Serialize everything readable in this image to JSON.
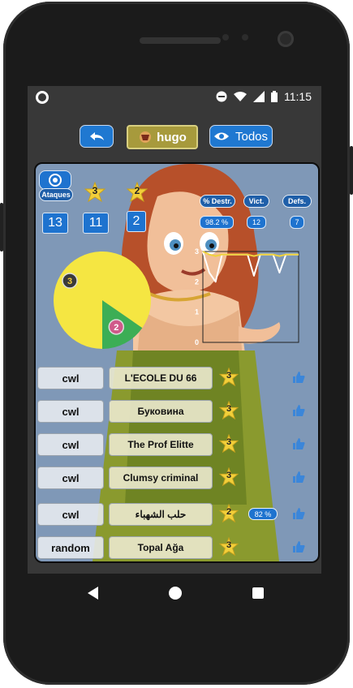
{
  "status": {
    "time": "11:15"
  },
  "toolbar": {
    "back_icon": "undo-icon",
    "player_name": "hugo",
    "filter_label": "Todos"
  },
  "stats": {
    "ataques_label": "Ataques",
    "ataques": "13",
    "three_star": "3",
    "three_star_count": "11",
    "two_star": "2",
    "two_star_count": "2",
    "destr_label": "% Destr.",
    "destr_value": "98.2 %",
    "vict_label": "Vict.",
    "vict_value": "12",
    "defs_label": "Defs.",
    "defs_value": "7"
  },
  "chart_data": [
    {
      "type": "pie",
      "slices": [
        {
          "label": "3",
          "value": 11,
          "color": "#f5e642"
        },
        {
          "label": "2",
          "value": 2,
          "color": "#3cae55"
        }
      ]
    },
    {
      "type": "line",
      "ylim": [
        0,
        3
      ],
      "yticks": [
        "0",
        "1",
        "2",
        "3"
      ],
      "series": [
        {
          "color": "#ffffff",
          "values": [
            3,
            2.3,
            2.0,
            2.9,
            2.9,
            2.9,
            2.9,
            2.9,
            2.2,
            2.9,
            2.9,
            2.9,
            2.3,
            2.9,
            2.9,
            2.9
          ]
        },
        {
          "color": "#f0d23c",
          "values": [
            3,
            2.9,
            2.85,
            2.9,
            2.9,
            2.9,
            2.9,
            2.9,
            2.85,
            2.9,
            2.9,
            2.9,
            2.85,
            2.9,
            2.9,
            2.9
          ]
        }
      ]
    }
  ],
  "rows": [
    {
      "type": "cwl",
      "name": "L'ECOLE DU 66",
      "stars": "3",
      "pct": ""
    },
    {
      "type": "cwl",
      "name": "Буковина",
      "stars": "3",
      "pct": ""
    },
    {
      "type": "cwl",
      "name": "The Prof Elitte",
      "stars": "3",
      "pct": ""
    },
    {
      "type": "cwl",
      "name": "Clumsy criminal",
      "stars": "3",
      "pct": ""
    },
    {
      "type": "cwl",
      "name": "حلب الشهباء",
      "stars": "2",
      "pct": "82 %"
    },
    {
      "type": "random",
      "name": "Topal Ağa",
      "stars": "3",
      "pct": ""
    }
  ],
  "colors": {
    "accent": "#1f78d1",
    "olive": "#a79a3c",
    "screen_bg": "#383838",
    "panel_bg": "#7f98b7"
  }
}
